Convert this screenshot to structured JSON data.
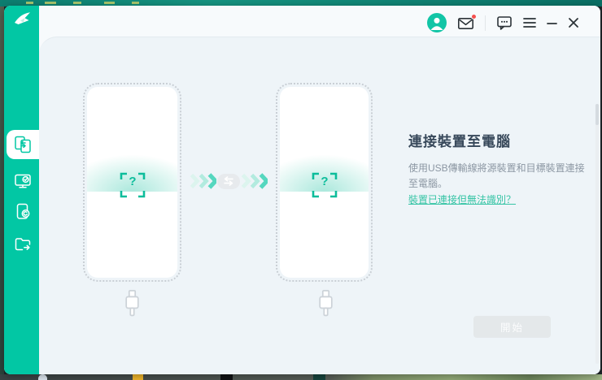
{
  "titlebar": {
    "account_icon": "user-avatar-icon",
    "mail_icon": "envelope-icon",
    "mail_notification": true,
    "feedback_icon": "chat-bubble-icon",
    "menu_icon": "hamburger-menu-icon",
    "minimize_icon": "minimize-icon",
    "close_icon": "close-icon"
  },
  "sidebar": {
    "logo_icon": "brand-swoosh-logo",
    "items": [
      {
        "id": "phone-to-phone-transfer",
        "icon": "phone-transfer-icon",
        "active": true
      },
      {
        "id": "computer-transfer",
        "icon": "computer-check-icon",
        "active": false
      },
      {
        "id": "phone-backup-restore",
        "icon": "phone-restore-icon",
        "active": false
      },
      {
        "id": "data-export",
        "icon": "folder-export-icon",
        "active": false
      }
    ]
  },
  "connect_screen": {
    "title": "連接裝置至電腦",
    "description": "使用USB傳輸線將源裝置和目標裝置連接至電腦。",
    "help_link": "裝置已連接但無法識別？",
    "start_button": "開始",
    "source_device_placeholder": "?",
    "target_device_placeholder": "?",
    "source_cable_icon": "usb-plug-icon",
    "target_cable_icon": "usb-plug-icon",
    "transfer_direction_icon": "swap-arrows-icon"
  },
  "colors": {
    "brand_teal": "#02c7a4",
    "link_teal": "#35c4a5",
    "panel_background": "#eef4f8",
    "notification_red": "#f5504e",
    "disabled_button": "#e4e8ea"
  }
}
